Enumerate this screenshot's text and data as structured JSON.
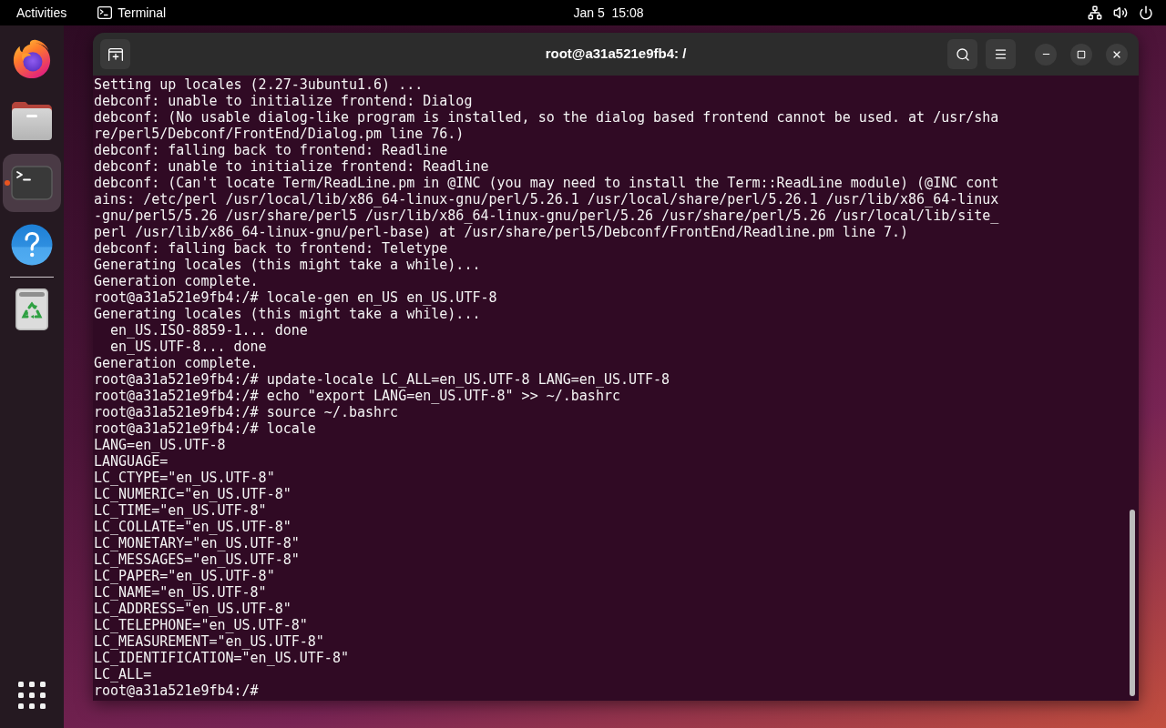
{
  "top_bar": {
    "activities": "Activities",
    "app_menu": "Terminal",
    "clock": "Jan 5  15:08"
  },
  "dock": {
    "favorites": [
      {
        "kind": "browser",
        "selected": false,
        "running": false
      },
      {
        "kind": "files",
        "selected": false,
        "running": false
      },
      {
        "kind": "terminal",
        "selected": true,
        "running": true
      },
      {
        "kind": "help",
        "selected": false,
        "running": false
      }
    ],
    "trash": {
      "selected": false,
      "running": false
    }
  },
  "terminal": {
    "title": "root@a31a521e9fb4: /",
    "lines": [
      "Setting up locales (2.27-3ubuntu1.6) ...",
      "debconf: unable to initialize frontend: Dialog",
      "debconf: (No usable dialog-like program is installed, so the dialog based frontend cannot be used. at /usr/sha",
      "re/perl5/Debconf/FrontEnd/Dialog.pm line 76.)",
      "debconf: falling back to frontend: Readline",
      "debconf: unable to initialize frontend: Readline",
      "debconf: (Can't locate Term/ReadLine.pm in @INC (you may need to install the Term::ReadLine module) (@INC cont",
      "ains: /etc/perl /usr/local/lib/x86_64-linux-gnu/perl/5.26.1 /usr/local/share/perl/5.26.1 /usr/lib/x86_64-linux",
      "-gnu/perl5/5.26 /usr/share/perl5 /usr/lib/x86_64-linux-gnu/perl/5.26 /usr/share/perl/5.26 /usr/local/lib/site_",
      "perl /usr/lib/x86_64-linux-gnu/perl-base) at /usr/share/perl5/Debconf/FrontEnd/Readline.pm line 7.)",
      "debconf: falling back to frontend: Teletype",
      "Generating locales (this might take a while)...",
      "Generation complete.",
      "root@a31a521e9fb4:/# locale-gen en_US en_US.UTF-8",
      "Generating locales (this might take a while)...",
      "  en_US.ISO-8859-1... done",
      "  en_US.UTF-8... done",
      "Generation complete.",
      "root@a31a521e9fb4:/# update-locale LC_ALL=en_US.UTF-8 LANG=en_US.UTF-8",
      "root@a31a521e9fb4:/# echo \"export LANG=en_US.UTF-8\" >> ~/.bashrc",
      "root@a31a521e9fb4:/# source ~/.bashrc",
      "root@a31a521e9fb4:/# locale",
      "LANG=en_US.UTF-8",
      "LANGUAGE=",
      "LC_CTYPE=\"en_US.UTF-8\"",
      "LC_NUMERIC=\"en_US.UTF-8\"",
      "LC_TIME=\"en_US.UTF-8\"",
      "LC_COLLATE=\"en_US.UTF-8\"",
      "LC_MONETARY=\"en_US.UTF-8\"",
      "LC_MESSAGES=\"en_US.UTF-8\"",
      "LC_PAPER=\"en_US.UTF-8\"",
      "LC_NAME=\"en_US.UTF-8\"",
      "LC_ADDRESS=\"en_US.UTF-8\"",
      "LC_TELEPHONE=\"en_US.UTF-8\"",
      "LC_MEASUREMENT=\"en_US.UTF-8\"",
      "LC_IDENTIFICATION=\"en_US.UTF-8\"",
      "LC_ALL=",
      "root@a31a521e9fb4:/#"
    ]
  }
}
